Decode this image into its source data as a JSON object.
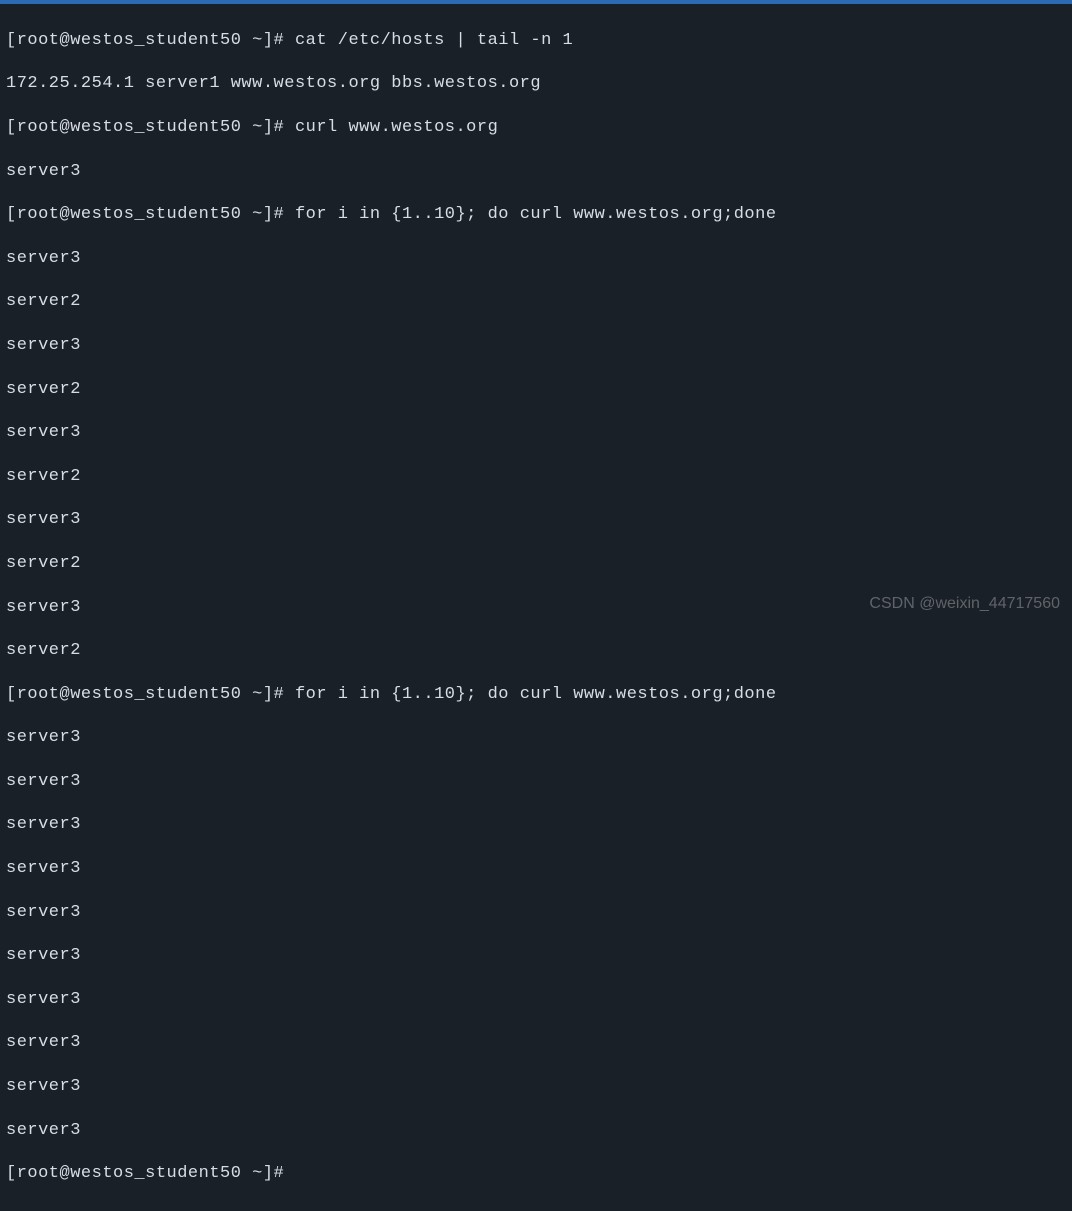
{
  "terminal": {
    "prompt": "[root@westos_student50 ~]# ",
    "commands": {
      "cat_hosts": "cat /etc/hosts | tail -n 1",
      "curl_single": "curl www.westos.org",
      "for_loop": "for i in {1..10}; do curl www.westos.org;done"
    },
    "outputs": {
      "hosts_line": "172.25.254.1 server1 www.westos.org bbs.westos.org",
      "single_curl": "server3",
      "loop1": [
        "server3",
        "server2",
        "server3",
        "server2",
        "server3",
        "server2",
        "server3",
        "server2",
        "server3",
        "server2"
      ],
      "loop2": [
        "server3",
        "server3",
        "server3",
        "server3",
        "server3",
        "server3",
        "server3",
        "server3",
        "server3",
        "server3"
      ]
    }
  },
  "watermark": "CSDN @weixin_44717560"
}
